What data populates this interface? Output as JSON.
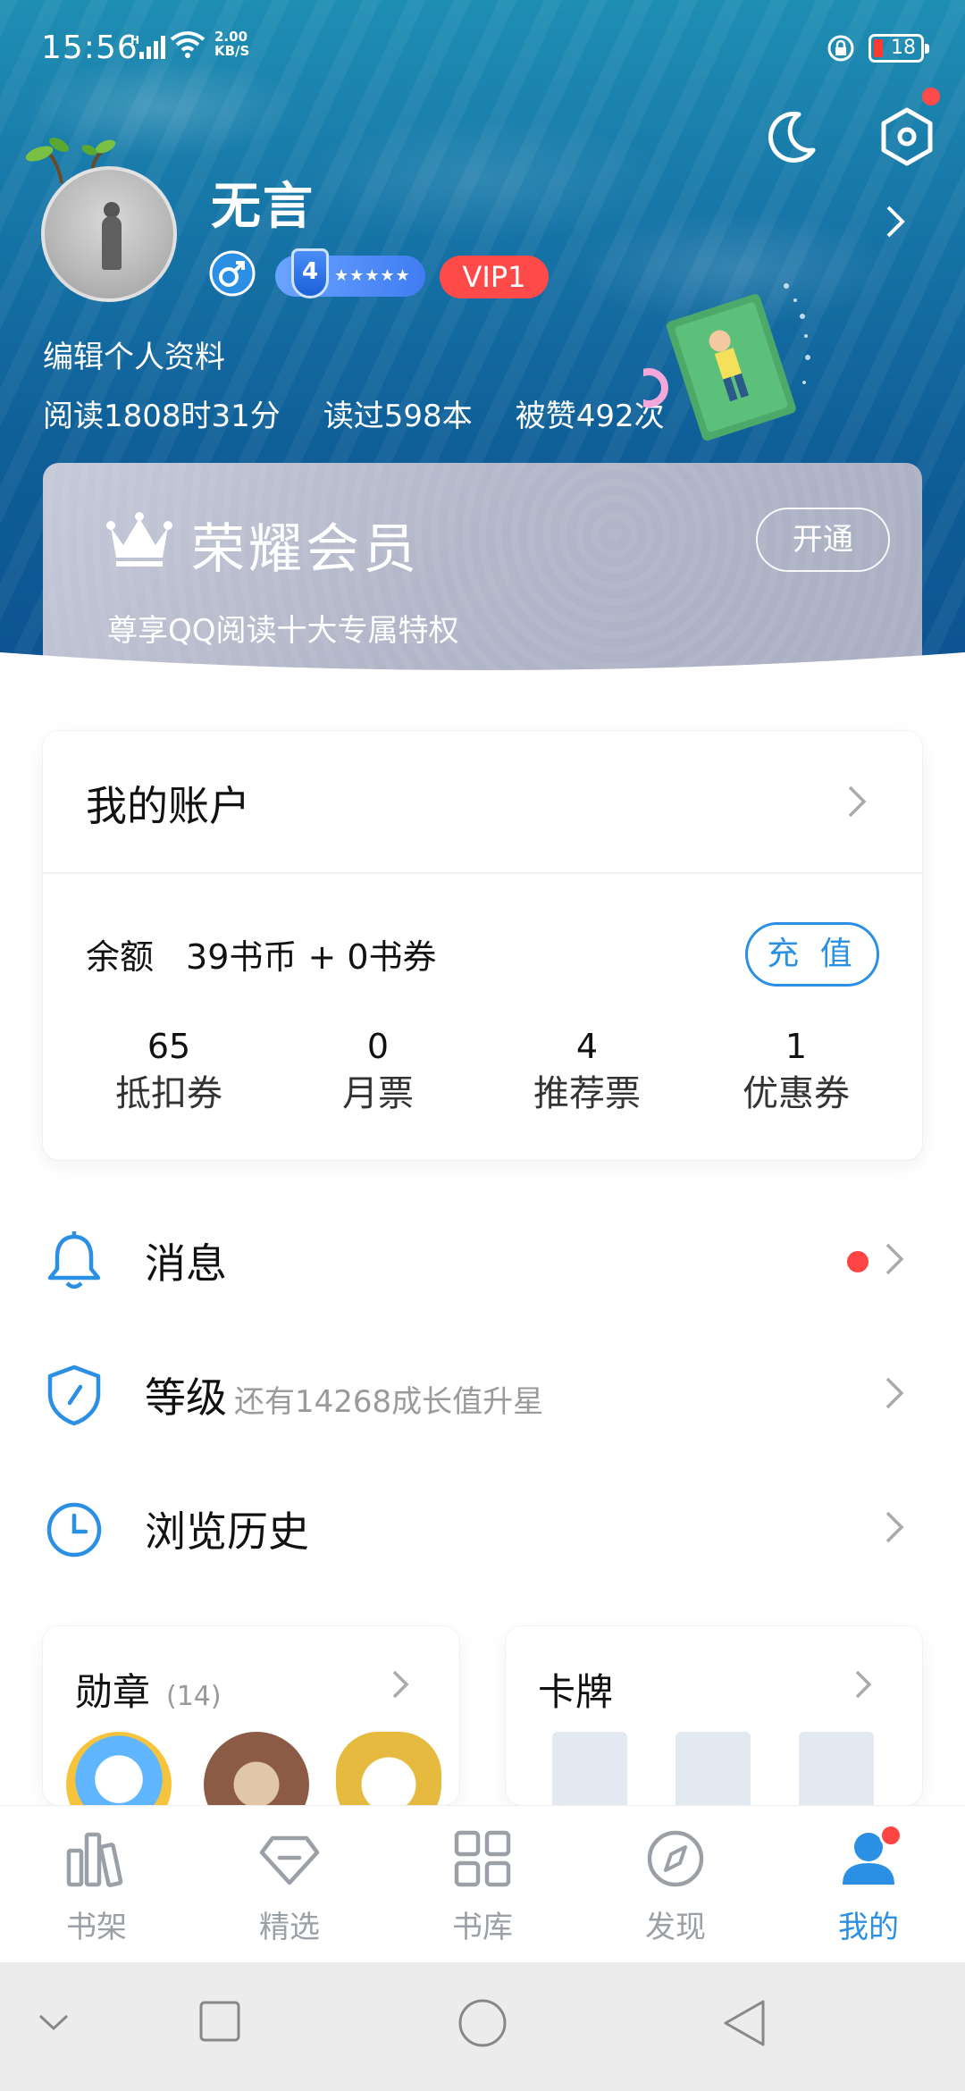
{
  "status": {
    "time": "15:56",
    "network": "H",
    "speed_value": "2.00",
    "speed_unit": "KB/S",
    "battery": "18"
  },
  "profile": {
    "username": "无言",
    "level": "4",
    "level_stars": "★★★★★",
    "vip": "VIP1",
    "edit_label": "编辑个人资料",
    "stats": {
      "read_time": "阅读1808时31分",
      "books_read": "读过598本",
      "likes": "被赞492次"
    }
  },
  "vip_card": {
    "title": "荣耀会员",
    "subtitle": "尊享QQ阅读十大专属特权",
    "button": "开通"
  },
  "account": {
    "title": "我的账户",
    "balance_label": "余额",
    "balance_value": "39书币 + 0书券",
    "recharge": "充 值",
    "tickets": [
      {
        "num": "65",
        "label": "抵扣券"
      },
      {
        "num": "0",
        "label": "月票"
      },
      {
        "num": "4",
        "label": "推荐票"
      },
      {
        "num": "1",
        "label": "优惠券"
      }
    ]
  },
  "menu": {
    "messages": "消息",
    "level": "等级",
    "level_sub": "还有14268成长值升星",
    "history": "浏览历史"
  },
  "medals": {
    "title": "勋章",
    "count": "(14)"
  },
  "cards": {
    "title": "卡牌"
  },
  "tabs": [
    {
      "label": "书架",
      "icon": "bookshelf-icon"
    },
    {
      "label": "精选",
      "icon": "diamond-icon"
    },
    {
      "label": "书库",
      "icon": "grid-icon"
    },
    {
      "label": "发现",
      "icon": "compass-icon"
    },
    {
      "label": "我的",
      "icon": "user-icon",
      "active": true
    }
  ],
  "colors": {
    "accent": "#2b8fe3",
    "badge_red": "#ff4a4a"
  }
}
